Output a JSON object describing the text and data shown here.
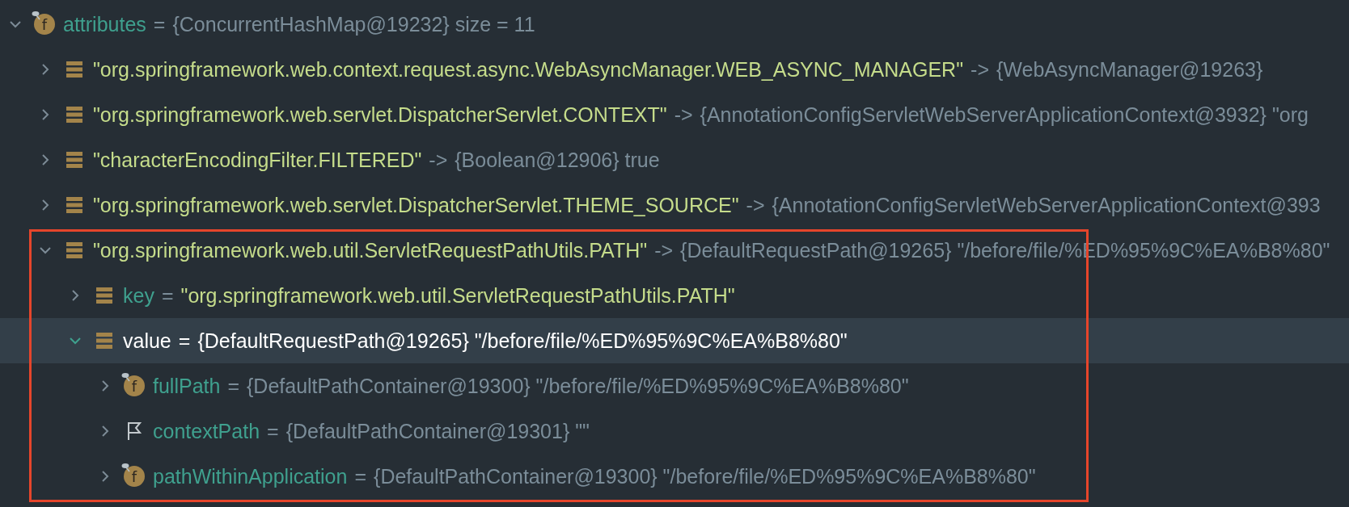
{
  "tree": [
    {
      "expanded": true,
      "selected": false,
      "highlighted": false,
      "icon": {
        "kind": "field",
        "glyph": "f"
      },
      "name": "attributes",
      "name_is_string": false,
      "operator": "=",
      "value": "{ConcurrentHashMap@19232}  size = 11",
      "value_is_string": false,
      "children": [
        {
          "expanded": false,
          "selected": false,
          "highlighted": false,
          "icon": {
            "kind": "entry"
          },
          "name": "\"org.springframework.web.context.request.async.WebAsyncManager.WEB_ASYNC_MANAGER\"",
          "name_is_string": true,
          "operator": "->",
          "value": "{WebAsyncManager@19263}",
          "value_is_string": false
        },
        {
          "expanded": false,
          "selected": false,
          "highlighted": false,
          "icon": {
            "kind": "entry"
          },
          "name": "\"org.springframework.web.servlet.DispatcherServlet.CONTEXT\"",
          "name_is_string": true,
          "operator": "->",
          "value": "{AnnotationConfigServletWebServerApplicationContext@3932} \"org",
          "value_is_string": false
        },
        {
          "expanded": false,
          "selected": false,
          "highlighted": false,
          "icon": {
            "kind": "entry"
          },
          "name": "\"characterEncodingFilter.FILTERED\"",
          "name_is_string": true,
          "operator": "->",
          "value": "{Boolean@12906} true",
          "value_is_string": false
        },
        {
          "expanded": false,
          "selected": false,
          "highlighted": false,
          "icon": {
            "kind": "entry"
          },
          "name": "\"org.springframework.web.servlet.DispatcherServlet.THEME_SOURCE\"",
          "name_is_string": true,
          "operator": "->",
          "value": "{AnnotationConfigServletWebServerApplicationContext@393",
          "value_is_string": false
        },
        {
          "expanded": true,
          "selected": false,
          "highlighted": true,
          "icon": {
            "kind": "entry"
          },
          "name": "\"org.springframework.web.util.ServletRequestPathUtils.PATH\"",
          "name_is_string": true,
          "operator": "->",
          "value": "{DefaultRequestPath@19265} \"/before/file/%ED%95%9C%EA%B8%80\"",
          "value_is_string": false,
          "children": [
            {
              "expanded": false,
              "selected": false,
              "highlighted": false,
              "icon": {
                "kind": "entry"
              },
              "name": "key",
              "name_is_string": false,
              "operator": "=",
              "value": "\"org.springframework.web.util.ServletRequestPathUtils.PATH\"",
              "value_is_string": true
            },
            {
              "expanded": true,
              "selected": true,
              "highlighted": false,
              "icon": {
                "kind": "entry"
              },
              "name": "value",
              "name_is_string": false,
              "operator": "=",
              "value": "{DefaultRequestPath@19265} \"/before/file/%ED%95%9C%EA%B8%80\"",
              "value_is_string": false,
              "children": [
                {
                  "expanded": false,
                  "selected": false,
                  "highlighted": false,
                  "icon": {
                    "kind": "field",
                    "glyph": "f"
                  },
                  "name": "fullPath",
                  "name_is_string": false,
                  "operator": "=",
                  "value": "{DefaultPathContainer@19300} \"/before/file/%ED%95%9C%EA%B8%80\"",
                  "value_is_string": false
                },
                {
                  "expanded": false,
                  "selected": false,
                  "highlighted": false,
                  "icon": {
                    "kind": "flag"
                  },
                  "name": "contextPath",
                  "name_is_string": false,
                  "operator": "=",
                  "value": "{DefaultPathContainer@19301} \"\"",
                  "value_is_string": false
                },
                {
                  "expanded": false,
                  "selected": false,
                  "highlighted": false,
                  "icon": {
                    "kind": "field",
                    "glyph": "f"
                  },
                  "name": "pathWithinApplication",
                  "name_is_string": false,
                  "operator": "=",
                  "value": "{DefaultPathContainer@19300} \"/before/file/%ED%95%9C%EA%B8%80\"",
                  "value_is_string": false
                }
              ]
            }
          ]
        }
      ]
    }
  ]
}
